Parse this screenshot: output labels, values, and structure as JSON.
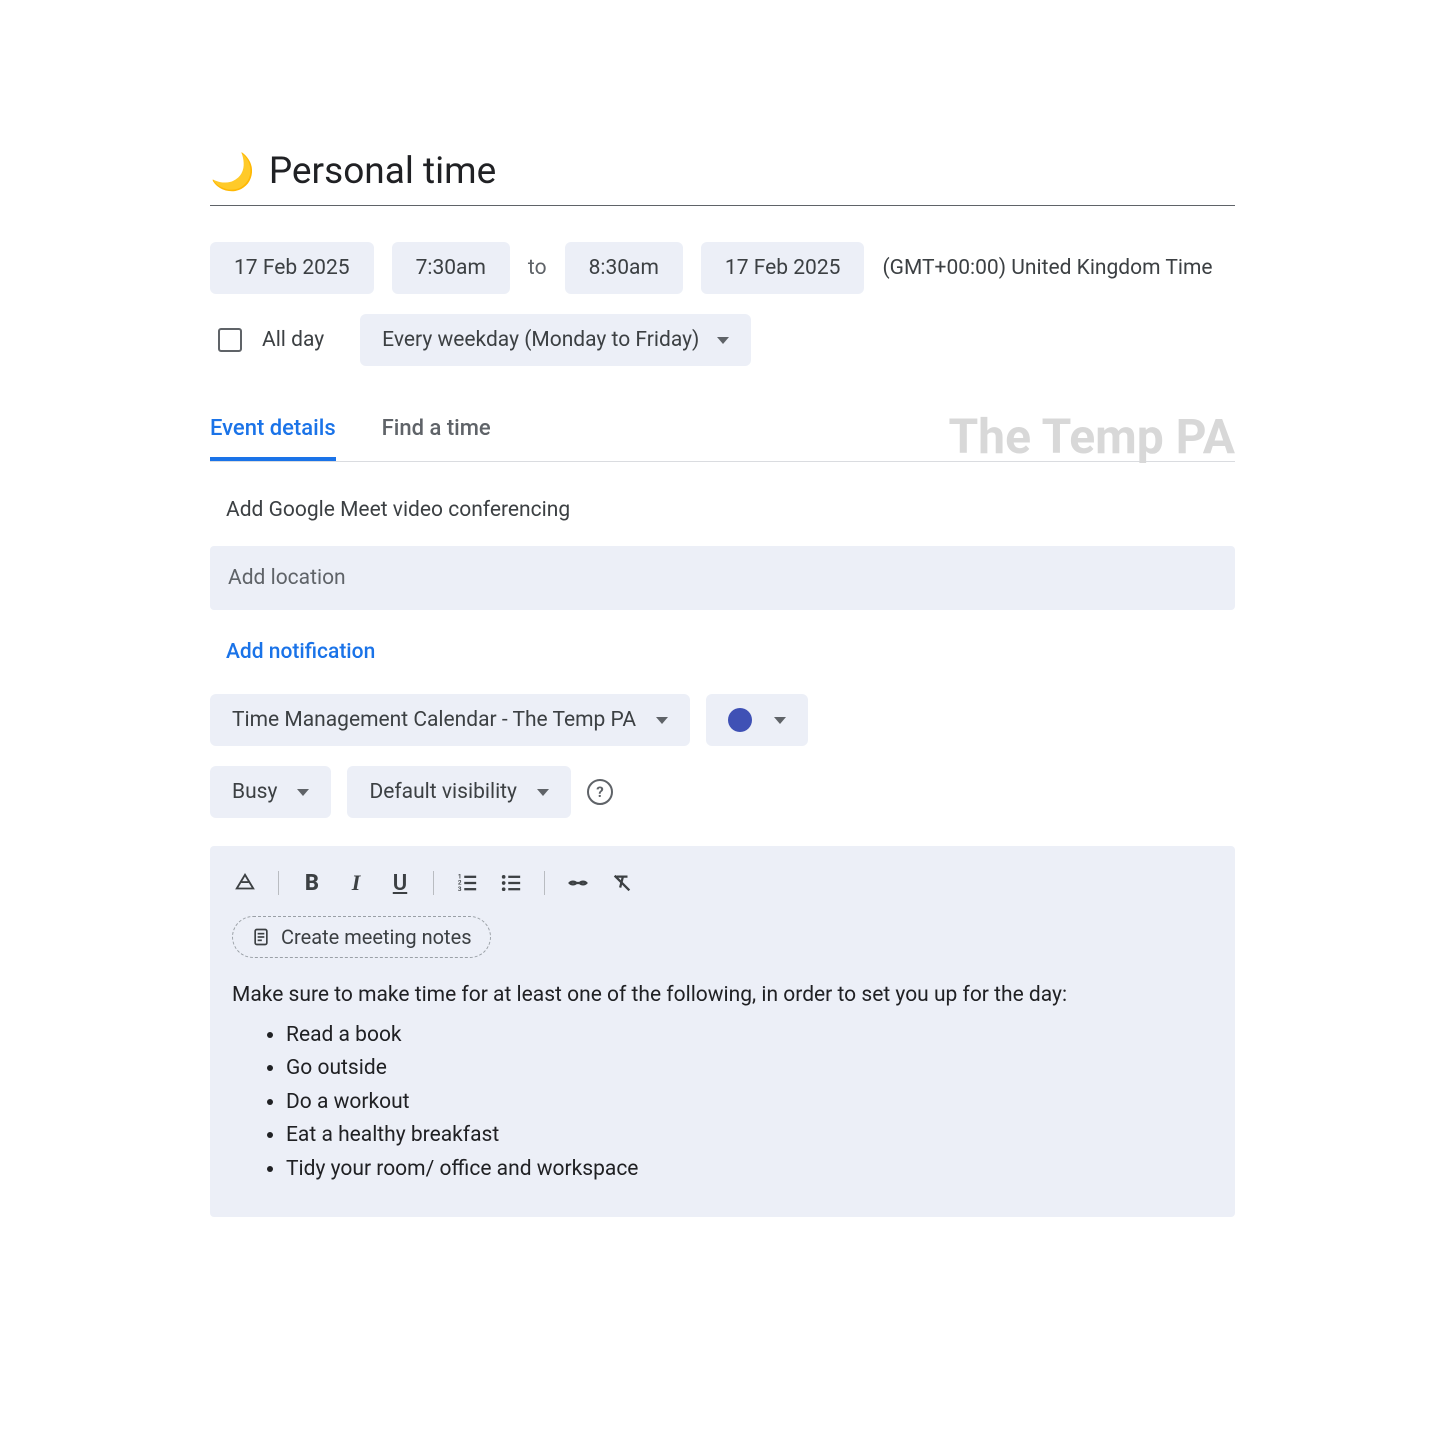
{
  "title": {
    "icon": "🌙",
    "text": "Personal time"
  },
  "date": {
    "start_date": "17 Feb 2025",
    "start_time": "7:30am",
    "to": "to",
    "end_time": "8:30am",
    "end_date": "17 Feb 2025",
    "timezone": "(GMT+00:00) United Kingdom Time"
  },
  "allday": {
    "label": "All day",
    "recurrence": "Every weekday (Monday to Friday)"
  },
  "tabs": {
    "details": "Event details",
    "find": "Find a time"
  },
  "watermark": "The Temp PA",
  "details": {
    "meet": "Add Google Meet video conferencing",
    "location_placeholder": "Add location",
    "notification": "Add notification",
    "calendar": "Time Management Calendar - The Temp PA",
    "color": "#3f51b5",
    "availability": "Busy",
    "visibility": "Default visibility",
    "notes_chip": "Create meeting notes",
    "description_intro": "Make sure to make time for at least one of the following, in order to set you up for the day:",
    "description_items": [
      "Read a book",
      "Go outside",
      "Do a workout",
      "Eat a healthy breakfast",
      "Tidy your room/ office and workspace"
    ]
  }
}
